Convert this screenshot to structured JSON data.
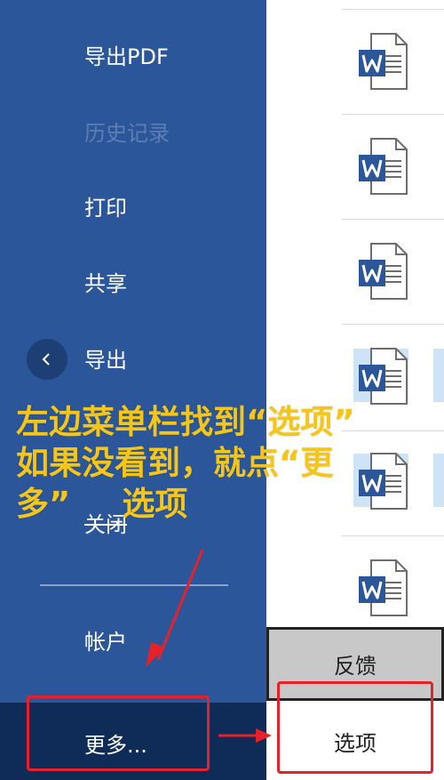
{
  "sidebar": {
    "items": [
      {
        "label": "导出PDF",
        "enabled": true
      },
      {
        "label": "历史记录",
        "enabled": false
      },
      {
        "label": "打印",
        "enabled": true
      },
      {
        "label": "共享",
        "enabled": true
      },
      {
        "label": "导出",
        "enabled": true
      },
      {
        "label": "关闭",
        "enabled": true
      },
      {
        "label": "帐户",
        "enabled": true
      }
    ],
    "more_label": "更多...",
    "back_icon": "chevron-left-icon",
    "colors": {
      "bg": "#2b579a",
      "more_bg": "#0f2c59"
    }
  },
  "popup": {
    "feedback_label": "反馈",
    "options_label": "选项"
  },
  "documents": {
    "icon": "word-document-icon",
    "rows": [
      "",
      "",
      "",
      "",
      "",
      ""
    ]
  },
  "annotation": {
    "lines": [
      "左边菜单栏找到“选项”",
      "如果没看到，就点“更",
      "多”"
    ],
    "tail": "选项",
    "color": "#f5c518",
    "highlight_color": "#e8202a"
  }
}
